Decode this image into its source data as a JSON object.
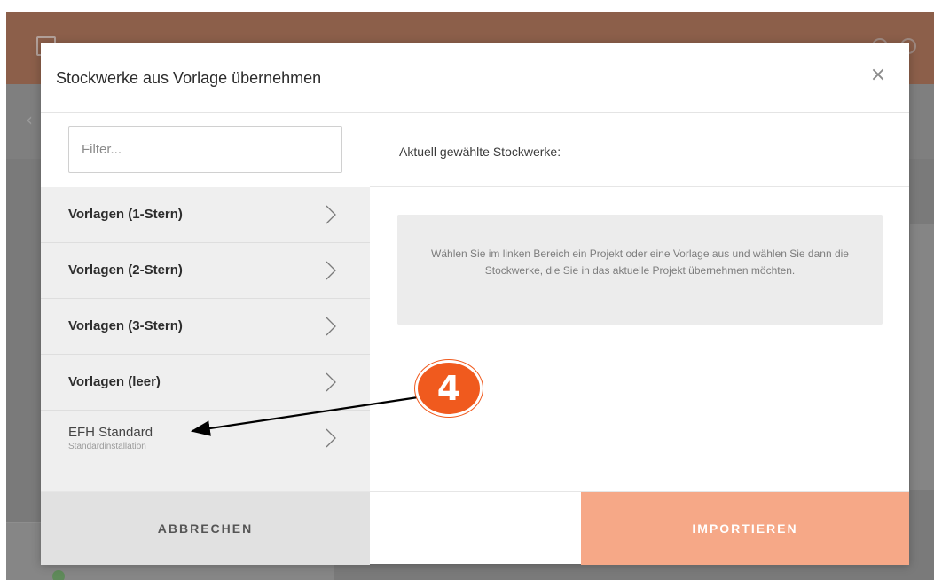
{
  "modal": {
    "title": "Stockwerke aus Vorlage übernehmen",
    "close_symbol": "×"
  },
  "filter": {
    "placeholder": "Filter..."
  },
  "template_list": [
    {
      "label": "Vorlagen (1-Stern)",
      "sublabel": "",
      "bold": true
    },
    {
      "label": "Vorlagen (2-Stern)",
      "sublabel": "",
      "bold": true
    },
    {
      "label": "Vorlagen (3-Stern)",
      "sublabel": "",
      "bold": true
    },
    {
      "label": "Vorlagen (leer)",
      "sublabel": "",
      "bold": true
    },
    {
      "label": "EFH Standard",
      "sublabel": "Standardinstallation",
      "bold": false
    }
  ],
  "selection": {
    "label": "Aktuell gewählte Stockwerke:",
    "info": "Wählen Sie im linken Bereich ein Projekt oder eine Vorlage aus und wählen Sie dann die Stockwerke, die Sie in das aktuelle Projekt übernehmen möchten."
  },
  "footer": {
    "cancel_label": "ABBRECHEN",
    "import_label": "IMPORTIEREN"
  },
  "annotation": {
    "step_number": "4"
  },
  "icons": {
    "close": "close-icon",
    "chevron": "chevron-right-icon"
  },
  "colors": {
    "import_button": "#f6a887",
    "cancel_button": "#e1e1e1",
    "step_badge": "#f05a1e",
    "list_background": "#efefef"
  }
}
